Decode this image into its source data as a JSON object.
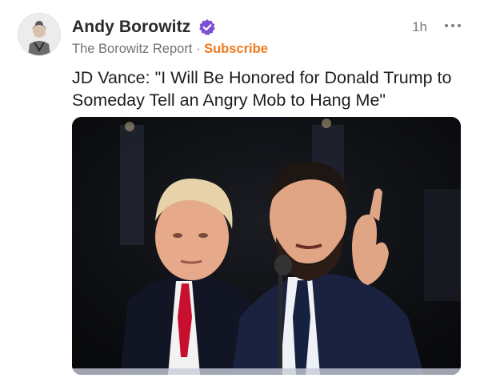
{
  "post": {
    "author_name": "Andy Borowitz",
    "publication": "The Borowitz Report",
    "separator": "·",
    "subscribe_label": "Subscribe",
    "timestamp": "1h",
    "headline": "JD Vance: \"I Will Be Honored for Donald Trump to Someday Tell an Angry Mob to Hang Me\""
  },
  "icons": {
    "verified": "verified-badge-icon",
    "more": "more-options-icon"
  },
  "colors": {
    "accent": "#f0791b",
    "verified": "#7b4fd6",
    "muted_text": "#737373"
  }
}
